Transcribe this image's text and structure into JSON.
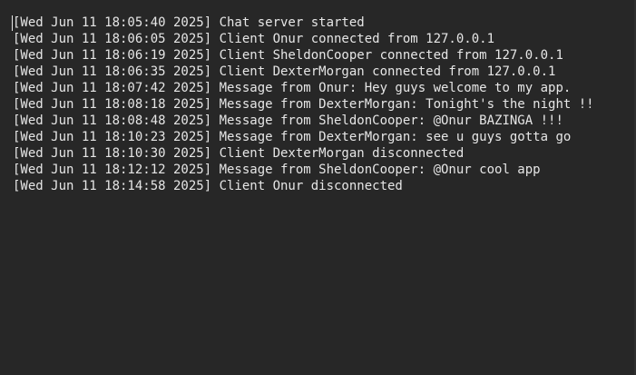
{
  "terminal": {
    "lines": [
      "[Wed Jun 11 18:05:40 2025] Chat server started",
      "[Wed Jun 11 18:06:05 2025] Client Onur connected from 127.0.0.1",
      "[Wed Jun 11 18:06:19 2025] Client SheldonCooper connected from 127.0.0.1",
      "[Wed Jun 11 18:06:35 2025] Client DexterMorgan connected from 127.0.0.1",
      "[Wed Jun 11 18:07:42 2025] Message from Onur: Hey guys welcome to my app.",
      "[Wed Jun 11 18:08:18 2025] Message from DexterMorgan: Tonight's the night !!",
      "[Wed Jun 11 18:08:48 2025] Message from SheldonCooper: @Onur BAZINGA !!!",
      "[Wed Jun 11 18:10:23 2025] Message from DexterMorgan: see u guys gotta go",
      "[Wed Jun 11 18:10:30 2025] Client DexterMorgan disconnected",
      "[Wed Jun 11 18:12:12 2025] Message from SheldonCooper: @Onur cool app",
      "[Wed Jun 11 18:14:58 2025] Client Onur disconnected"
    ]
  },
  "colors": {
    "background": "#272727",
    "text": "#e6e6e6"
  }
}
